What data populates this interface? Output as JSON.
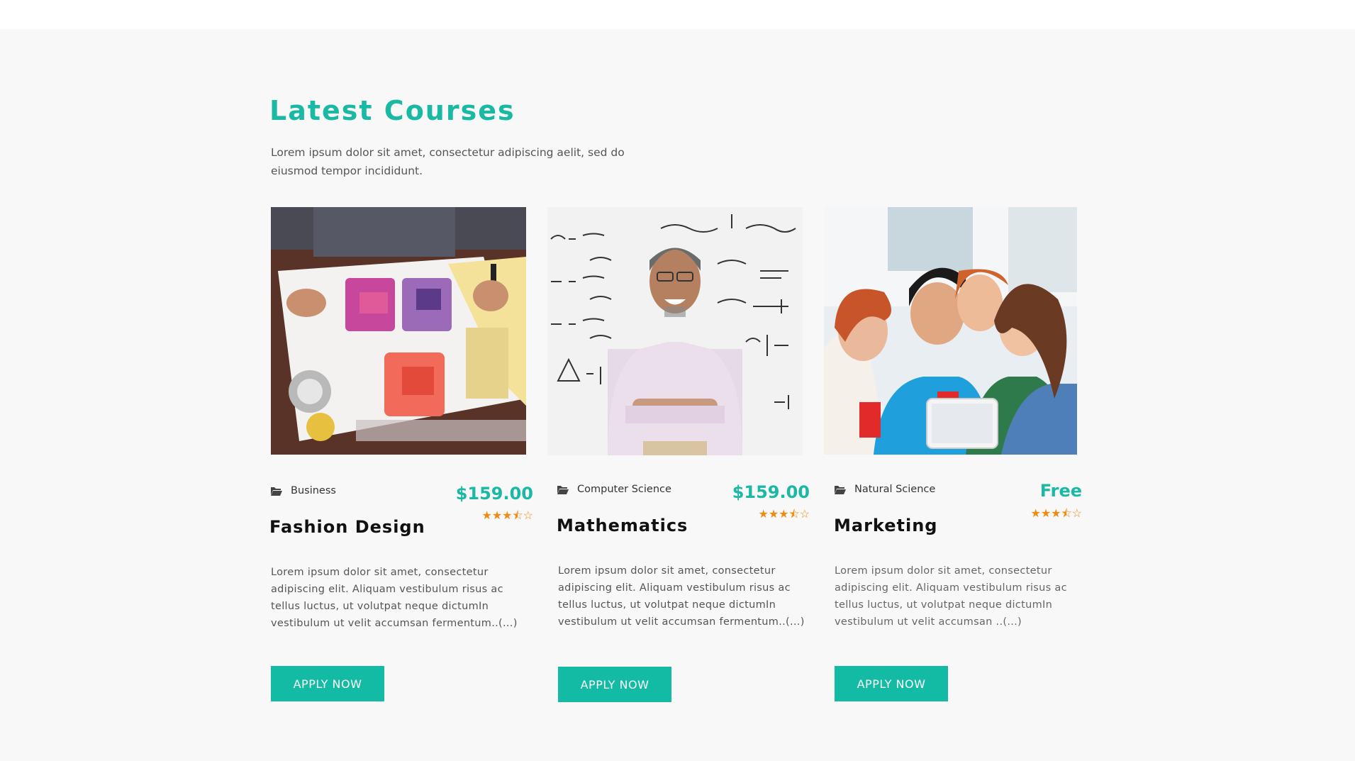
{
  "section": {
    "title": "Latest Courses",
    "description": "Lorem ipsum dolor sit amet, consectetur adipiscing aelit, sed do eiusmod tempor incididunt."
  },
  "colors": {
    "accent": "#1ab9a4",
    "button": "#14bba4",
    "star": "#f08a12",
    "background": "#f8f8f8"
  },
  "courses": [
    {
      "category_icon": "folder-open-icon",
      "category": "Business",
      "price": "$159.00",
      "rating": 3.5,
      "rating_max": 5,
      "title": "Fashion Design",
      "description": "Lorem ipsum dolor sit amet, consectetur adipiscing elit. Aliquam vestibulum risus ac tellus luctus, ut volutpat neque dictumIn vestibulum ut velit accumsan fermentum..(...)",
      "button_label": "APPLY NOW"
    },
    {
      "category_icon": "folder-open-icon",
      "category": "Computer Science",
      "price": "$159.00",
      "rating": 3.5,
      "rating_max": 5,
      "title": "Mathematics",
      "description": "Lorem ipsum dolor sit amet, consectetur adipiscing elit. Aliquam vestibulum risus ac tellus luctus, ut volutpat neque dictumIn vestibulum ut velit accumsan fermentum..(...)",
      "button_label": "APPLY NOW"
    },
    {
      "category_icon": "folder-open-icon",
      "category": "Natural Science",
      "price": "Free",
      "rating": 3.5,
      "rating_max": 5,
      "title": "Marketing",
      "description": "Lorem ipsum dolor sit amet, consectetur adipiscing elit. Aliquam vestibulum risus ac tellus luctus, ut volutpat neque dictumIn vestibulum ut velit accumsan ..(...)",
      "button_label": "APPLY NOW"
    }
  ]
}
